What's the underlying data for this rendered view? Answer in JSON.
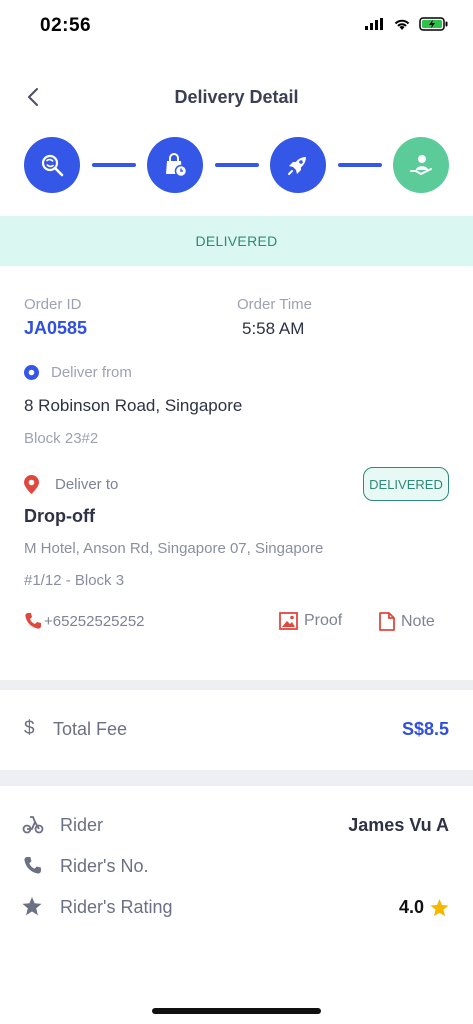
{
  "status_bar": {
    "time": "02:56"
  },
  "header": {
    "title": "Delivery Detail"
  },
  "steps": [
    {
      "icon": "search-refresh-icon",
      "color": "#3457e8"
    },
    {
      "icon": "bag-clock-icon",
      "color": "#3457e8"
    },
    {
      "icon": "rocket-icon",
      "color": "#3457e8"
    },
    {
      "icon": "hand-receive-icon",
      "color": "#5ccb9a"
    }
  ],
  "status_banner": "DELIVERED",
  "order": {
    "id_label": "Order ID",
    "id_value": "JA0585",
    "time_label": "Order Time",
    "time_value": "5:58 AM"
  },
  "pickup": {
    "label": "Deliver from",
    "address": "8 Robinson Road, Singapore",
    "detail": "Block 23#2"
  },
  "dropoff": {
    "label": "Deliver to",
    "badge": "DELIVERED",
    "title": "Drop-off",
    "address": "M Hotel, Anson Rd, Singapore 07, Singapore",
    "detail": "#1/12 - Block 3",
    "phone": "+65252525252",
    "proof_label": "Proof",
    "note_label": "Note"
  },
  "fee": {
    "label": "Total Fee",
    "value": "S$8.5"
  },
  "rider": {
    "name_label": "Rider",
    "name_value": "James Vu A",
    "number_label": "Rider's No.",
    "rating_label": "Rider's Rating",
    "rating_value": "4.0"
  },
  "colors": {
    "primary": "#3457e8",
    "success": "#5ccb9a",
    "danger": "#e0483f",
    "banner_bg": "#dbf7f1"
  }
}
